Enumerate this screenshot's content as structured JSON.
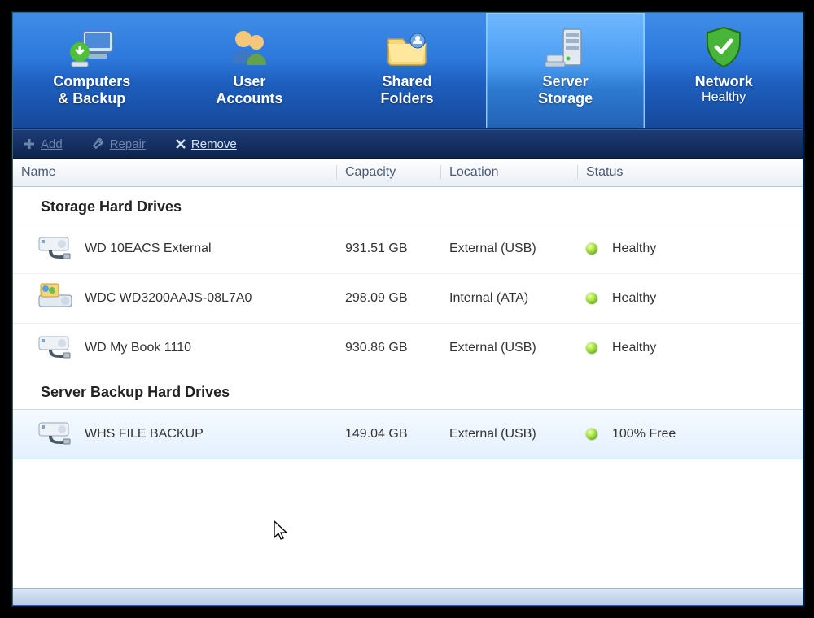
{
  "nav": [
    {
      "line1": "Computers",
      "line2": "& Backup",
      "icon": "computers"
    },
    {
      "line1": "User",
      "line2": "Accounts",
      "icon": "users"
    },
    {
      "line1": "Shared",
      "line2": "Folders",
      "icon": "folders"
    },
    {
      "line1": "Server",
      "line2": "Storage",
      "icon": "server",
      "selected": true
    },
    {
      "line1": "Network",
      "line2": "Healthy",
      "icon": "shield",
      "sub_is_status": true
    }
  ],
  "toolbar": {
    "add": {
      "label": "Add",
      "enabled": false
    },
    "repair": {
      "label": "Repair",
      "enabled": false
    },
    "remove": {
      "label": "Remove",
      "enabled": true
    }
  },
  "columns": {
    "name": "Name",
    "capacity": "Capacity",
    "location": "Location",
    "status": "Status"
  },
  "groups": [
    {
      "title": "Storage Hard Drives",
      "rows": [
        {
          "name": "WD 10EACS External",
          "capacity": "931.51 GB",
          "location": "External (USB)",
          "status": "Healthy",
          "icon": "ext"
        },
        {
          "name": "WDC WD3200AAJS-08L7A0",
          "capacity": "298.09 GB",
          "location": "Internal (ATA)",
          "status": "Healthy",
          "icon": "system"
        },
        {
          "name": "WD My Book 1110",
          "capacity": "930.86 GB",
          "location": "External (USB)",
          "status": "Healthy",
          "icon": "ext"
        }
      ]
    },
    {
      "title": "Server Backup Hard Drives",
      "rows": [
        {
          "name": "WHS FILE BACKUP",
          "capacity": "149.04 GB",
          "location": "External (USB)",
          "status": "100% Free",
          "icon": "ext",
          "selected": true
        }
      ]
    }
  ]
}
